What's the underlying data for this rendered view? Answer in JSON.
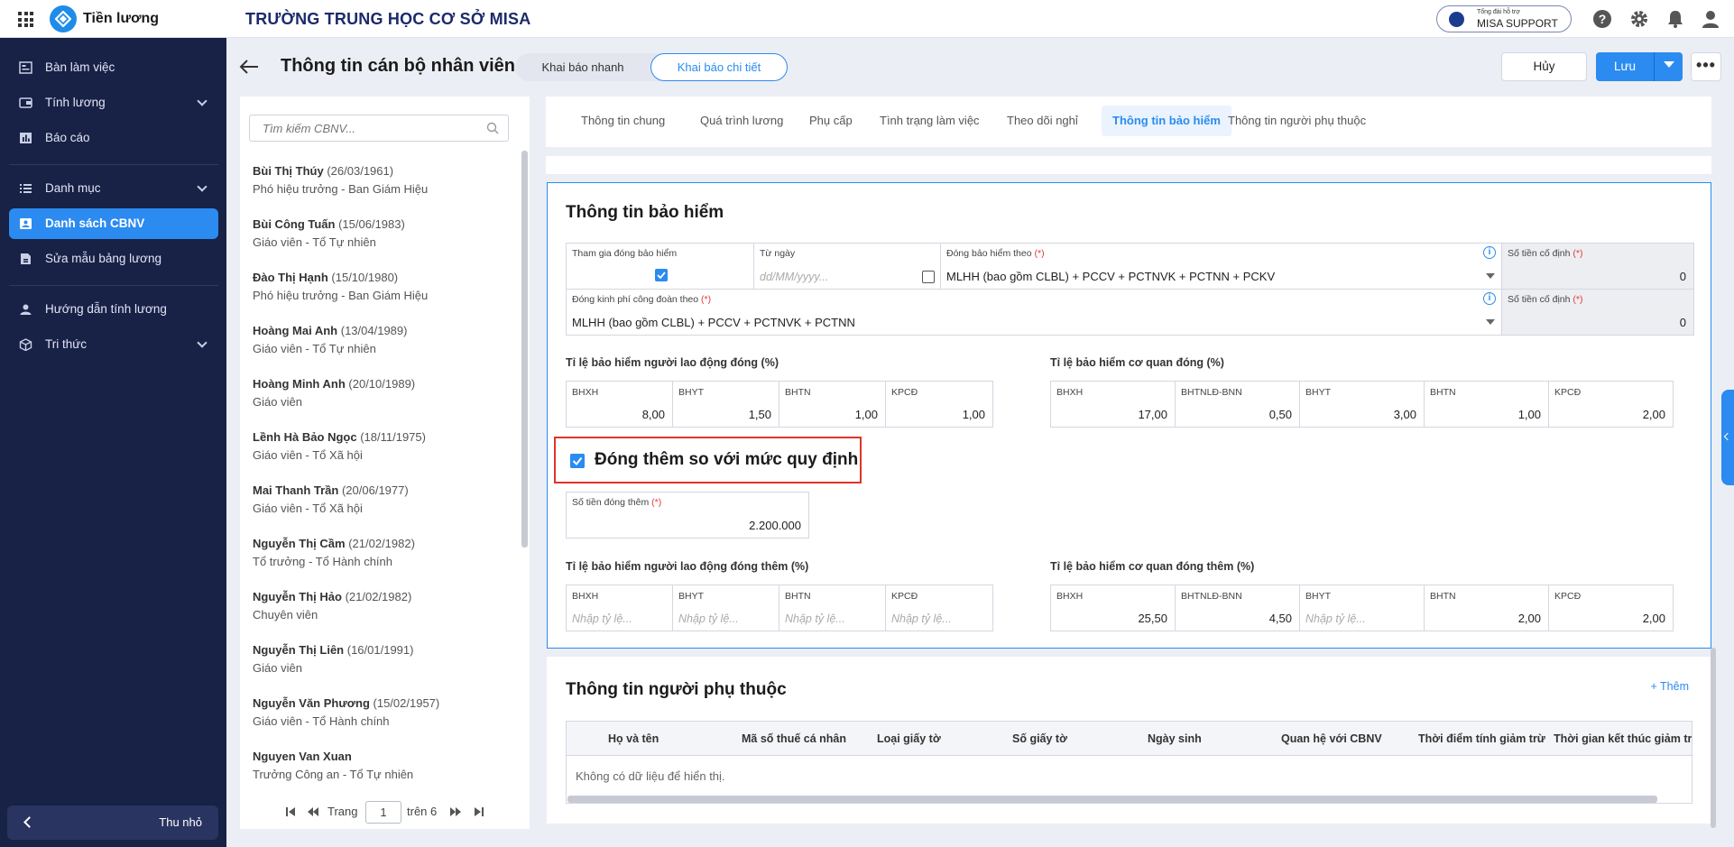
{
  "topbar": {
    "app_name": "Tiền lương",
    "school_name": "TRƯỜNG TRUNG HỌC CƠ SỞ MISA",
    "support_small": "Tổng đài hỗ trợ",
    "support_label": "MISA SUPPORT"
  },
  "sidebar": {
    "items": [
      {
        "label": "Bàn làm việc"
      },
      {
        "label": "Tính lương"
      },
      {
        "label": "Báo cáo"
      },
      {
        "label": "Danh mục"
      },
      {
        "label": "Danh sách CBNV"
      },
      {
        "label": "Sửa mẫu bảng lương"
      },
      {
        "label": "Hướng dẫn tính lương"
      },
      {
        "label": "Tri thức"
      }
    ],
    "collapse_label": "Thu nhỏ"
  },
  "header": {
    "title": "Thông tin cán bộ nhân viên",
    "seg_quick": "Khai báo nhanh",
    "seg_detail": "Khai báo chi tiết",
    "cancel": "Hủy",
    "save": "Lưu",
    "more": "•••"
  },
  "employee_list": {
    "search_placeholder": "Tìm kiếm CBNV...",
    "employees": [
      {
        "name": "Bùi Thị Thúy",
        "dob": "(26/03/1961)",
        "position": "Phó hiệu trưởng - Ban Giám Hiệu"
      },
      {
        "name": "Bùi Công Tuấn",
        "dob": "(15/06/1983)",
        "position": "Giáo viên - Tổ Tự nhiên"
      },
      {
        "name": "Đào Thị Hạnh",
        "dob": "(15/10/1980)",
        "position": "Phó hiệu trưởng - Ban Giám Hiệu"
      },
      {
        "name": "Hoàng Mai Anh",
        "dob": "(13/04/1989)",
        "position": "Giáo viên - Tổ Tự nhiên"
      },
      {
        "name": "Hoàng Minh Anh",
        "dob": "(20/10/1989)",
        "position": "Giáo viên"
      },
      {
        "name": "Lềnh Hà Bảo Ngọc",
        "dob": "(18/11/1975)",
        "position": "Giáo viên - Tổ Xã hội"
      },
      {
        "name": "Mai Thanh Trần",
        "dob": "(20/06/1977)",
        "position": "Giáo viên - Tổ Xã hội"
      },
      {
        "name": "Nguyễn Thị Cầm",
        "dob": "(21/02/1982)",
        "position": "Tổ trưởng - Tổ Hành chính"
      },
      {
        "name": "Nguyễn Thị Hảo",
        "dob": "(21/02/1982)",
        "position": "Chuyên viên"
      },
      {
        "name": "Nguyễn Thị Liên",
        "dob": "(16/01/1991)",
        "position": "Giáo viên"
      },
      {
        "name": "Nguyễn Văn Phương",
        "dob": "(15/02/1957)",
        "position": "Giáo viên - Tổ Hành chính"
      },
      {
        "name": "Nguyen Van Xuan",
        "dob": "",
        "position": "Trưởng Công an - Tổ Tự nhiên"
      }
    ],
    "pager": {
      "page_label": "Trang",
      "page": "1",
      "of_label": "trên 6"
    }
  },
  "tabs": [
    {
      "label": "Thông tin chung"
    },
    {
      "label": "Quá trình lương"
    },
    {
      "label": "Phụ cấp"
    },
    {
      "label": "Tình trạng làm việc"
    },
    {
      "label": "Theo dõi nghỉ"
    },
    {
      "label": "Thông tin bảo hiểm"
    },
    {
      "label": "Thông tin người phụ thuộc"
    }
  ],
  "insurance": {
    "title": "Thông tin bảo hiểm",
    "participate_label": "Tham gia đóng bảo hiểm",
    "participate_checked": true,
    "from_date_label": "Từ ngày",
    "from_date_placeholder": "dd/MM/yyyy...",
    "pay_by_label": "Đóng bảo hiểm theo",
    "pay_by_value": "MLHH (bao gồm CLBL) + PCCV + PCTNVK + PCTNN + PCKV",
    "fixed_amount_label": "Số tiền cố định",
    "fixed_amount_1": "0",
    "union_label": "Đóng kinh phí công đoàn theo",
    "union_value": "MLHH (bao gồm CLBL) + PCCV + PCTNVK + PCTNN",
    "fixed_amount_2": "0",
    "required_mark": "(*)",
    "employee_rate_title": "Tỉ lệ bảo hiểm người lao động đóng (%)",
    "employee_rates": [
      {
        "label": "BHXH",
        "value": "8,00"
      },
      {
        "label": "BHYT",
        "value": "1,50"
      },
      {
        "label": "BHTN",
        "value": "1,00"
      },
      {
        "label": "KPCĐ",
        "value": "1,00"
      }
    ],
    "agency_rate_title": "Tỉ lệ bảo hiểm cơ quan đóng (%)",
    "agency_rates": [
      {
        "label": "BHXH",
        "value": "17,00"
      },
      {
        "label": "BHTNLĐ-BNN",
        "value": "0,50"
      },
      {
        "label": "BHYT",
        "value": "3,00"
      },
      {
        "label": "BHTN",
        "value": "1,00"
      },
      {
        "label": "KPCĐ",
        "value": "2,00"
      }
    ],
    "extra_label": "Đóng thêm so với mức quy định",
    "extra_checked": true,
    "extra_amount_label": "Số tiền đóng thêm",
    "extra_amount": "2.200.000",
    "employee_extra_title": "Tỉ lệ bảo hiểm người lao động đóng thêm (%)",
    "rate_placeholder": "Nhập tỷ lệ...",
    "employee_extra_rates": [
      {
        "label": "BHXH"
      },
      {
        "label": "BHYT"
      },
      {
        "label": "BHTN"
      },
      {
        "label": "KPCĐ"
      }
    ],
    "agency_extra_title": "Tỉ lệ bảo hiểm cơ quan đóng thêm (%)",
    "agency_extra_rates": [
      {
        "label": "BHXH",
        "value": "25,50"
      },
      {
        "label": "BHTNLĐ-BNN",
        "value": "4,50"
      },
      {
        "label": "BHYT",
        "value": ""
      },
      {
        "label": "BHTN",
        "value": "2,00"
      },
      {
        "label": "KPCĐ",
        "value": "2,00"
      }
    ]
  },
  "dependents": {
    "title": "Thông tin người phụ thuộc",
    "add": "+ Thêm",
    "columns": [
      "Họ và tên",
      "Mã số thuế cá nhân",
      "Loại giấy tờ",
      "Số giấy tờ",
      "Ngày sinh",
      "Quan hệ với CBNV",
      "Thời điểm tính giảm trừ",
      "Thời gian kết thúc giảm trừ"
    ],
    "empty_text": "Không có dữ liệu để hiển thị."
  },
  "colors": {
    "accent": "#2b8bf0",
    "sidebar": "#182146",
    "highlight_border": "#e0332b"
  }
}
